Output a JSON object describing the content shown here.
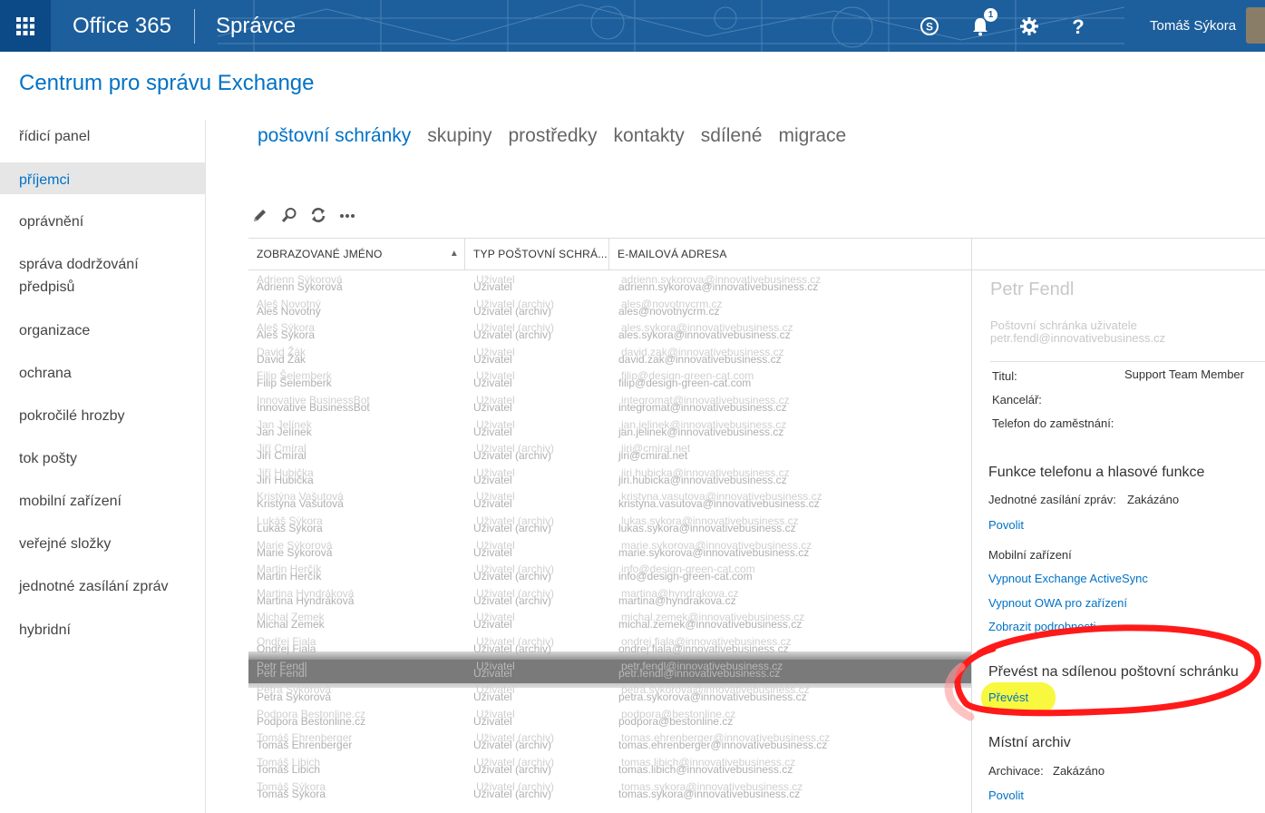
{
  "topbar": {
    "brand": "Office 365",
    "section": "Správce",
    "notification_count": "1",
    "user_name": "Tomáš Sýkora",
    "icons": [
      "app-launcher-icon",
      "skype-icon",
      "bell-icon",
      "gear-icon",
      "help-icon"
    ]
  },
  "header": {
    "title": "Centrum pro správu Exchange"
  },
  "nav": {
    "items": [
      {
        "label": "řídicí panel"
      },
      {
        "label": "příjemci"
      },
      {
        "label": "oprávnění"
      },
      {
        "label": "správa dodržování předpisů"
      },
      {
        "label": "organizace"
      },
      {
        "label": "ochrana"
      },
      {
        "label": "pokročilé hrozby"
      },
      {
        "label": "tok pošty"
      },
      {
        "label": "mobilní zařízení"
      },
      {
        "label": "veřejné složky"
      },
      {
        "label": "jednotné zasílání zpráv"
      },
      {
        "label": "hybridní"
      }
    ],
    "active_index": 1
  },
  "tabs": [
    {
      "label": "poštovní schránky"
    },
    {
      "label": "skupiny"
    },
    {
      "label": "prostředky"
    },
    {
      "label": "kontakty"
    },
    {
      "label": "sdílené"
    },
    {
      "label": "migrace"
    }
  ],
  "toolbar": [
    "pencil-icon",
    "search-icon",
    "refresh-icon",
    "more-icon"
  ],
  "grid": {
    "columns": [
      "ZOBRAZOVANÉ JMÉNO",
      "TYP POŠTOVNÍ SCHRÁ...",
      "E-MAILOVÁ ADRESA"
    ],
    "rows": [
      {
        "name": "Adrienn Sýkorová",
        "type": "Uživatel",
        "email": "adrienn.sykorova@innovativebusiness.cz"
      },
      {
        "name": "Aleš Novotný",
        "type": "Uživatel (archiv)",
        "email": "ales@novotnycrm.cz"
      },
      {
        "name": "Aleš Sýkora",
        "type": "Uživatel (archiv)",
        "email": "ales.sykora@innovativebusiness.cz"
      },
      {
        "name": "David Žák",
        "type": "Uživatel",
        "email": "david.zak@innovativebusiness.cz"
      },
      {
        "name": "Filip Šelemberk",
        "type": "Uživatel",
        "email": "filip@design-green-cat.com"
      },
      {
        "name": "Innovative BusinessBot",
        "type": "Uživatel",
        "email": "integromat@innovativebusiness.cz"
      },
      {
        "name": "Jan Jelínek",
        "type": "Uživatel",
        "email": "jan.jelinek@innovativebusiness.cz"
      },
      {
        "name": "Jiří Cmíral",
        "type": "Uživatel (archiv)",
        "email": "jiri@cmiral.net"
      },
      {
        "name": "Jiří Hubička",
        "type": "Uživatel",
        "email": "jiri.hubicka@innovativebusiness.cz"
      },
      {
        "name": "Kristýna Vašutová",
        "type": "Uživatel",
        "email": "kristyna.vasutova@innovativebusiness.cz"
      },
      {
        "name": "Lukáš Sýkora",
        "type": "Uživatel (archiv)",
        "email": "lukas.sykora@innovativebusiness.cz"
      },
      {
        "name": "Marie Sýkorová",
        "type": "Uživatel",
        "email": "marie.sykorova@innovativebusiness.cz"
      },
      {
        "name": "Martin Herčík",
        "type": "Uživatel (archiv)",
        "email": "info@design-green-cat.com"
      },
      {
        "name": "Martina Hyndráková",
        "type": "Uživatel (archiv)",
        "email": "martina@hyndrakova.cz"
      },
      {
        "name": "Michal Zemek",
        "type": "Uživatel",
        "email": "michal.zemek@innovativebusiness.cz"
      },
      {
        "name": "Ondřej Fiala",
        "type": "Uživatel (archiv)",
        "email": "ondrej.fiala@innovativebusiness.cz"
      },
      {
        "name": "Petr Fendl",
        "type": "Uživatel",
        "email": "petr.fendl@innovativebusiness.cz"
      },
      {
        "name": "Petra Sýkorová",
        "type": "Uživatel",
        "email": "petra.sykorova@innovativebusiness.cz"
      },
      {
        "name": "Podpora Bestonline.cz",
        "type": "Uživatel",
        "email": "podpora@bestonline.cz"
      },
      {
        "name": "Tomáš Ehrenberger",
        "type": "Uživatel (archiv)",
        "email": "tomas.ehrenberger@innovativebusiness.cz"
      },
      {
        "name": "Tomáš Libich",
        "type": "Uživatel (archiv)",
        "email": "tomas.libich@innovativebusiness.cz"
      },
      {
        "name": "Tomáš Sýkora",
        "type": "Uživatel (archiv)",
        "email": "tomas.sykora@innovativebusiness.cz"
      }
    ],
    "selected_index": 16
  },
  "details": {
    "name": "Petr Fendl",
    "subtitle": "Poštovní schránka uživatele",
    "email": "petr.fendl@innovativebusiness.cz",
    "title_label": "Titul:",
    "title_value": "Support Team Member",
    "office_label": "Kancelář:",
    "phone_label": "Telefon do zaměstnání:",
    "phone_section": "Funkce telefonu a hlasové funkce",
    "um_label": "Jednotné zasílání zpráv:",
    "um_value": "Zakázáno",
    "um_enable": "Povolit",
    "mobile_label": "Mobilní zařízení",
    "disable_eas": "Vypnout Exchange ActiveSync",
    "disable_owa": "Vypnout OWA pro zařízení",
    "show_details": "Zobrazit podrobnosti",
    "convert_section": "Převést na sdílenou poštovní schránku",
    "convert_link": "Převést",
    "archive_section": "Místní archiv",
    "archive_label": "Archivace:",
    "archive_value": "Zakázáno",
    "archive_enable": "Povolit"
  },
  "annotation_color": "#ff1a1a",
  "highlight_color": "#f7f72a",
  "brand_color": "#1d5f9c",
  "accent_color": "#0072c6"
}
